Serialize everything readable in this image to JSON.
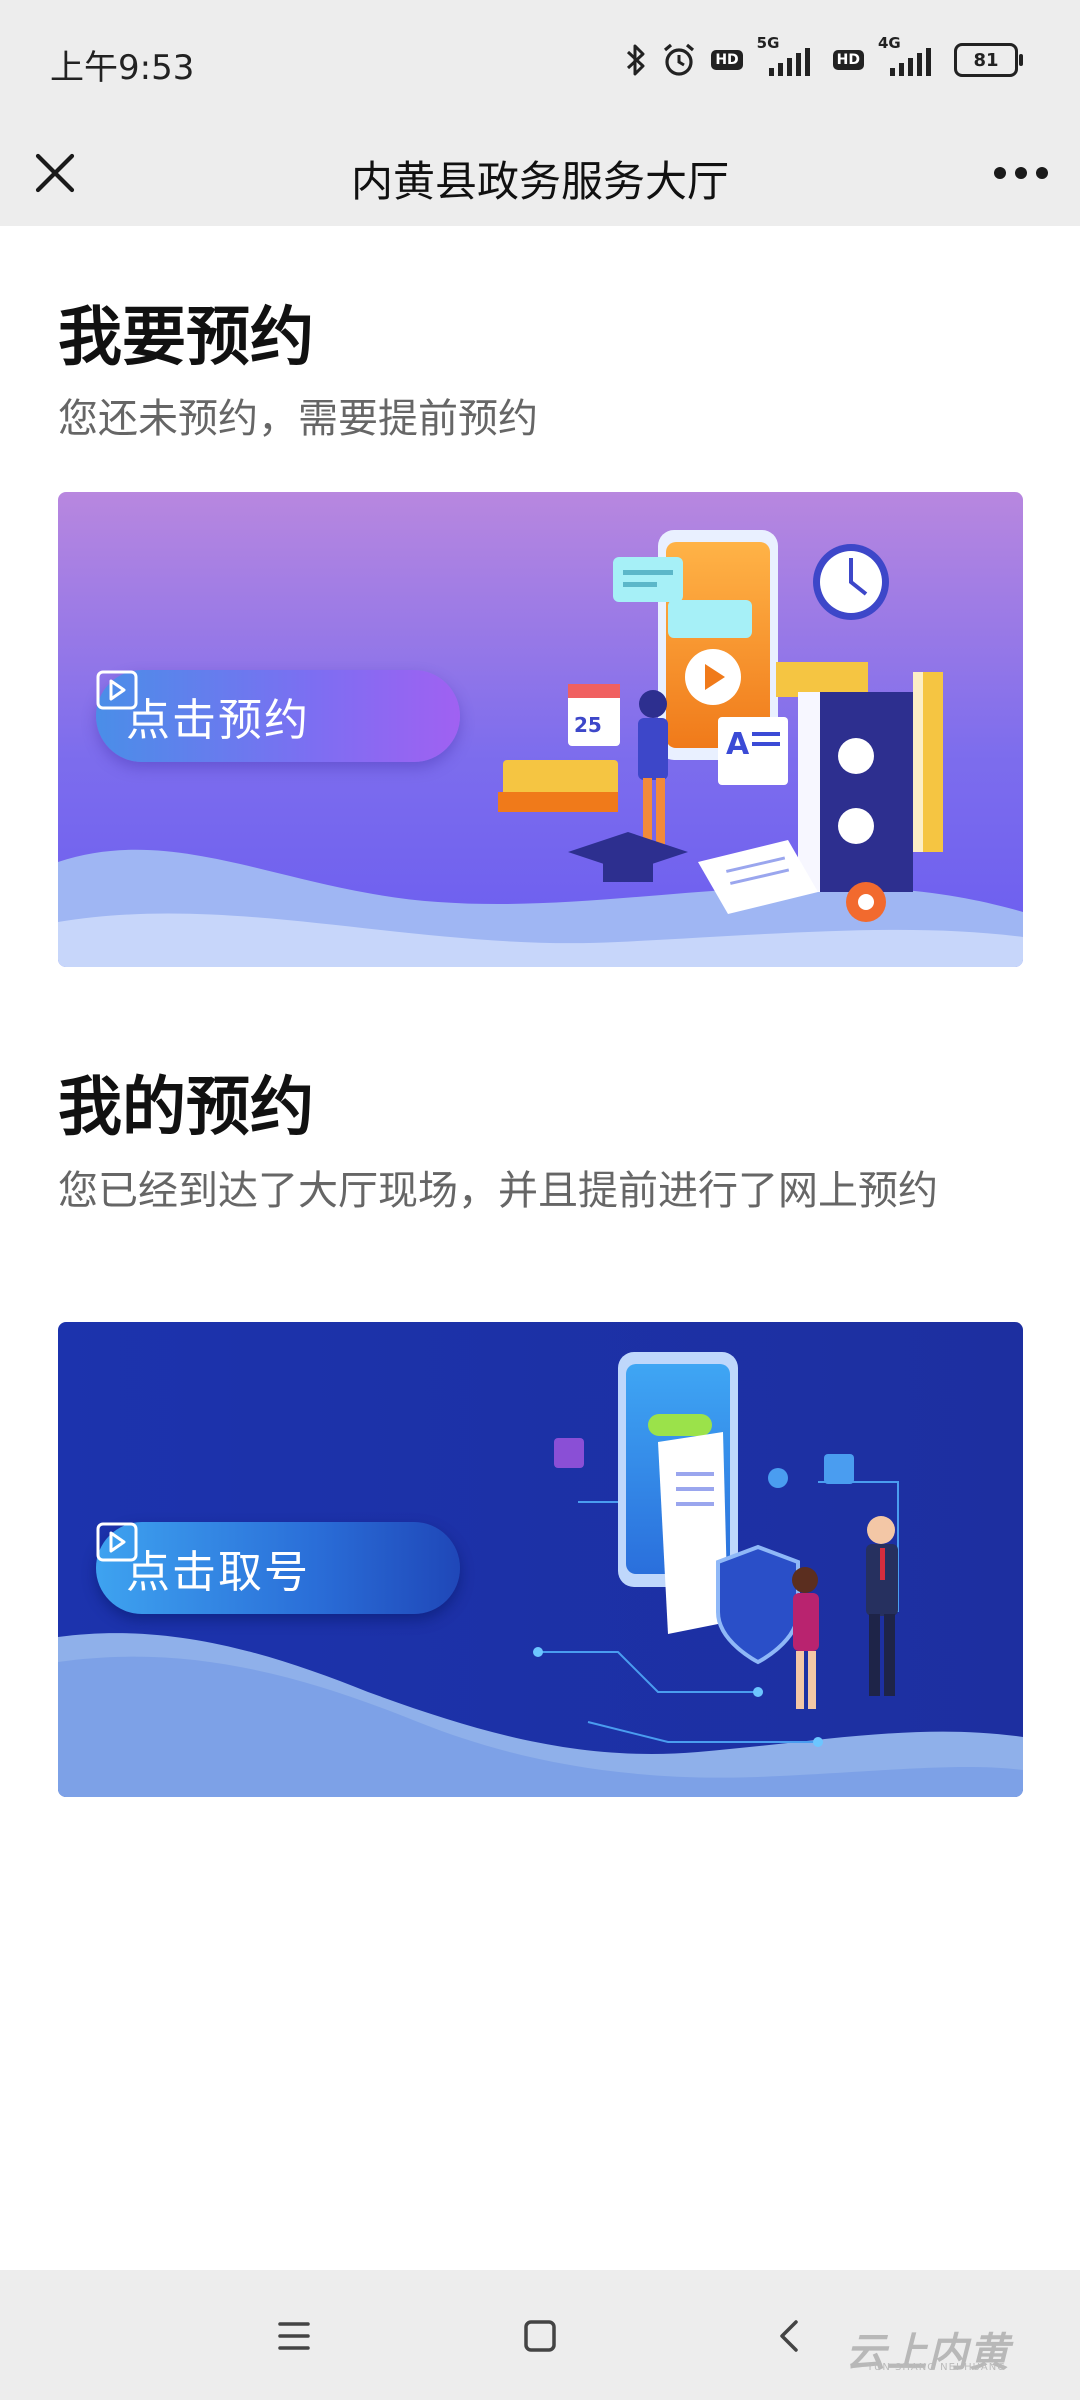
{
  "status_bar": {
    "time": "上午9:53",
    "hd_label": "HD",
    "net1_label": "5G",
    "net2_label": "4G",
    "battery": "81",
    "icons": [
      "bluetooth-icon",
      "alarm-icon",
      "hd-icon",
      "signal-5g-icon",
      "hd-icon",
      "signal-4g-icon",
      "battery-icon"
    ]
  },
  "title_bar": {
    "title": "内黄县政务服务大厅",
    "close_icon": "close-icon",
    "more_icon": "more-icon"
  },
  "section1": {
    "title": "我要预约",
    "description": "您还未预约，需要提前预约",
    "button_label": "点击预约",
    "button_icon": "play-icon",
    "banner_colors": [
      "#b484e0",
      "#6f63ec",
      "#a8c2f5"
    ]
  },
  "section2": {
    "title": "我的预约",
    "description": "您已经到达了大厅现场，并且提前进行了网上预约",
    "button_label": "点击取号",
    "button_icon": "play-icon",
    "banner_colors": [
      "#1a2fa8",
      "#223fbf",
      "#8fb3ec"
    ]
  },
  "nav_bar": {
    "icons": [
      "menu-icon",
      "home-icon",
      "back-icon"
    ],
    "watermark": "云上内黄",
    "watermark_sub": "YUN SHANG NEI HUANG"
  }
}
